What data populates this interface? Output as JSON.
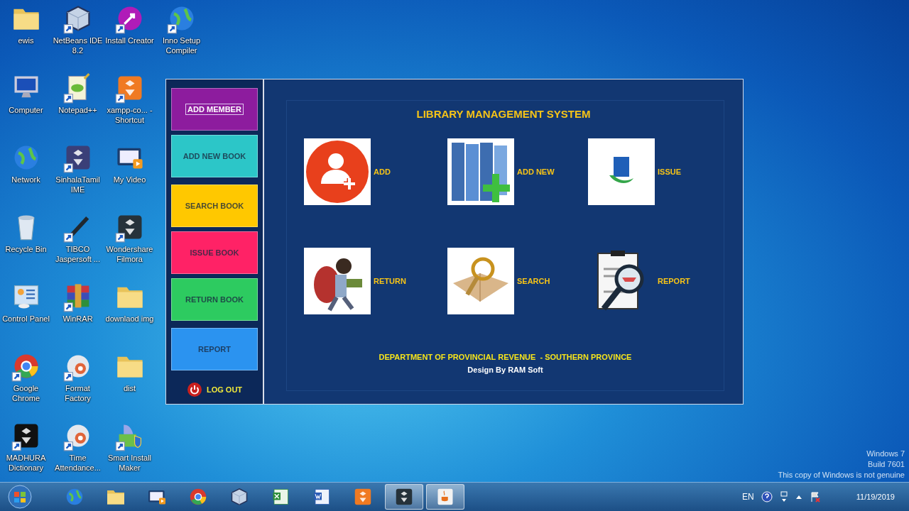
{
  "desktop": {
    "columns": [
      [
        {
          "label": "ewis",
          "kind": "folder",
          "shortcut": false
        },
        {
          "label": "Computer",
          "kind": "computer",
          "shortcut": false
        },
        {
          "label": "Network",
          "kind": "globe",
          "shortcut": false
        },
        {
          "label": "Recycle Bin",
          "kind": "trash",
          "shortcut": false
        },
        {
          "label": "Control Panel",
          "kind": "panel",
          "shortcut": false
        },
        {
          "label": "Google Chrome",
          "kind": "ring",
          "shortcut": true
        },
        {
          "label": "MADHURA Dictionary",
          "kind": "tile",
          "color": "#101010",
          "shortcut": true
        }
      ],
      [
        {
          "label": "NetBeans IDE 8.2",
          "kind": "cube",
          "shortcut": true
        },
        {
          "label": "Notepad++",
          "kind": "note",
          "shortcut": true
        },
        {
          "label": "SinhalaTamil IME",
          "kind": "tile",
          "color": "#3a3f78",
          "shortcut": true
        },
        {
          "label": "TIBCO Jaspersoft ...",
          "kind": "pen",
          "shortcut": true
        },
        {
          "label": "WinRAR",
          "kind": "archive",
          "shortcut": true
        },
        {
          "label": "Format Factory",
          "kind": "gear",
          "shortcut": true
        },
        {
          "label": "Time Attendance...",
          "kind": "gear",
          "shortcut": true
        }
      ],
      [
        {
          "label": "Install Creator",
          "kind": "disc",
          "color": "#b01cb8",
          "shortcut": true
        },
        {
          "label": "xampp-co... - Shortcut",
          "kind": "tile",
          "color": "#f07a22",
          "shortcut": true
        },
        {
          "label": "My Video",
          "kind": "video",
          "shortcut": false
        },
        {
          "label": "Wondershare Filmora",
          "kind": "tile",
          "color": "#26323a",
          "shortcut": true
        },
        {
          "label": "downlaod img",
          "kind": "folder",
          "shortcut": false
        },
        {
          "label": "dist",
          "kind": "folder",
          "shortcut": false
        },
        {
          "label": "Smart Install Maker",
          "kind": "box",
          "shortcut": true
        }
      ],
      [
        {
          "label": "Inno Setup Compiler",
          "kind": "globe",
          "shortcut": true
        }
      ]
    ]
  },
  "app": {
    "sidebar": {
      "buttons": [
        {
          "label": "ADD MEMBER",
          "color": "#8d1c9e",
          "focused": true
        },
        {
          "label": "ADD NEW BOOK",
          "color": "#2cc6c8",
          "focused": false
        },
        {
          "label": "SEARCH BOOK",
          "color": "#ffc800",
          "focused": false
        },
        {
          "label": "ISSUE BOOK",
          "color": "#ff2266",
          "focused": false
        },
        {
          "label": "RETURN BOOK",
          "color": "#2dcb60",
          "focused": false
        },
        {
          "label": "REPORT",
          "color": "#2b93f0",
          "focused": false
        }
      ],
      "logout": {
        "label": "LOG OUT"
      }
    },
    "title": "LIBRARY MANAGEMENT SYSTEM",
    "tiles": [
      {
        "label": "ADD",
        "kind": "person-add"
      },
      {
        "label": "ADD NEW",
        "kind": "books"
      },
      {
        "label": "ISSUE",
        "kind": "book"
      },
      {
        "label": "RETURN",
        "kind": "student"
      },
      {
        "label": "SEARCH",
        "kind": "magnifier-book"
      },
      {
        "label": "REPORT",
        "kind": "clipboard"
      }
    ],
    "footer": {
      "department": "DEPARTMENT OF PROVINCIAL REVENUE  - SOUTHERN PROVINCE",
      "credit": "Design By RAM Soft"
    }
  },
  "notice": [
    "Windows 7",
    "Build 7601",
    "This copy of Windows is not genuine"
  ],
  "taskbar": {
    "items": [
      {
        "kind": "globe",
        "active": false
      },
      {
        "kind": "folder",
        "active": false
      },
      {
        "kind": "video",
        "active": false
      },
      {
        "kind": "ring",
        "active": false
      },
      {
        "kind": "cube",
        "active": false
      },
      {
        "kind": "sheet",
        "active": false
      },
      {
        "kind": "doc",
        "active": false
      },
      {
        "kind": "tile",
        "color": "#f07a22",
        "active": false
      },
      {
        "kind": "tile",
        "color": "#26323a",
        "active": true
      },
      {
        "kind": "cup",
        "active": true
      }
    ],
    "tray": {
      "language": "EN",
      "date": "11/19/2019"
    }
  }
}
